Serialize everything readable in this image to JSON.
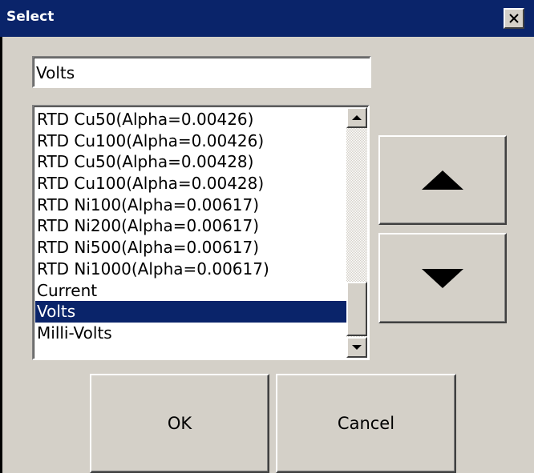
{
  "window": {
    "title": "Select",
    "close_glyph": "✕"
  },
  "selection_field": {
    "value": "Volts"
  },
  "list": {
    "items": [
      "RTD Cu50(Alpha=0.00426)",
      "RTD Cu100(Alpha=0.00426)",
      "RTD Cu50(Alpha=0.00428)",
      "RTD Cu100(Alpha=0.00428)",
      "RTD Ni100(Alpha=0.00617)",
      "RTD Ni200(Alpha=0.00617)",
      "RTD Ni500(Alpha=0.00617)",
      "RTD Ni1000(Alpha=0.00617)",
      "Current",
      "Volts",
      "Milli-Volts"
    ],
    "selected": "Volts"
  },
  "buttons": {
    "up_icon": "up-arrow-icon",
    "down_icon": "down-arrow-icon",
    "ok_label": "OK",
    "cancel_label": "Cancel"
  },
  "colors": {
    "titlebar": "#0a246a",
    "face": "#d4d0c8",
    "selection": "#0a246a"
  }
}
